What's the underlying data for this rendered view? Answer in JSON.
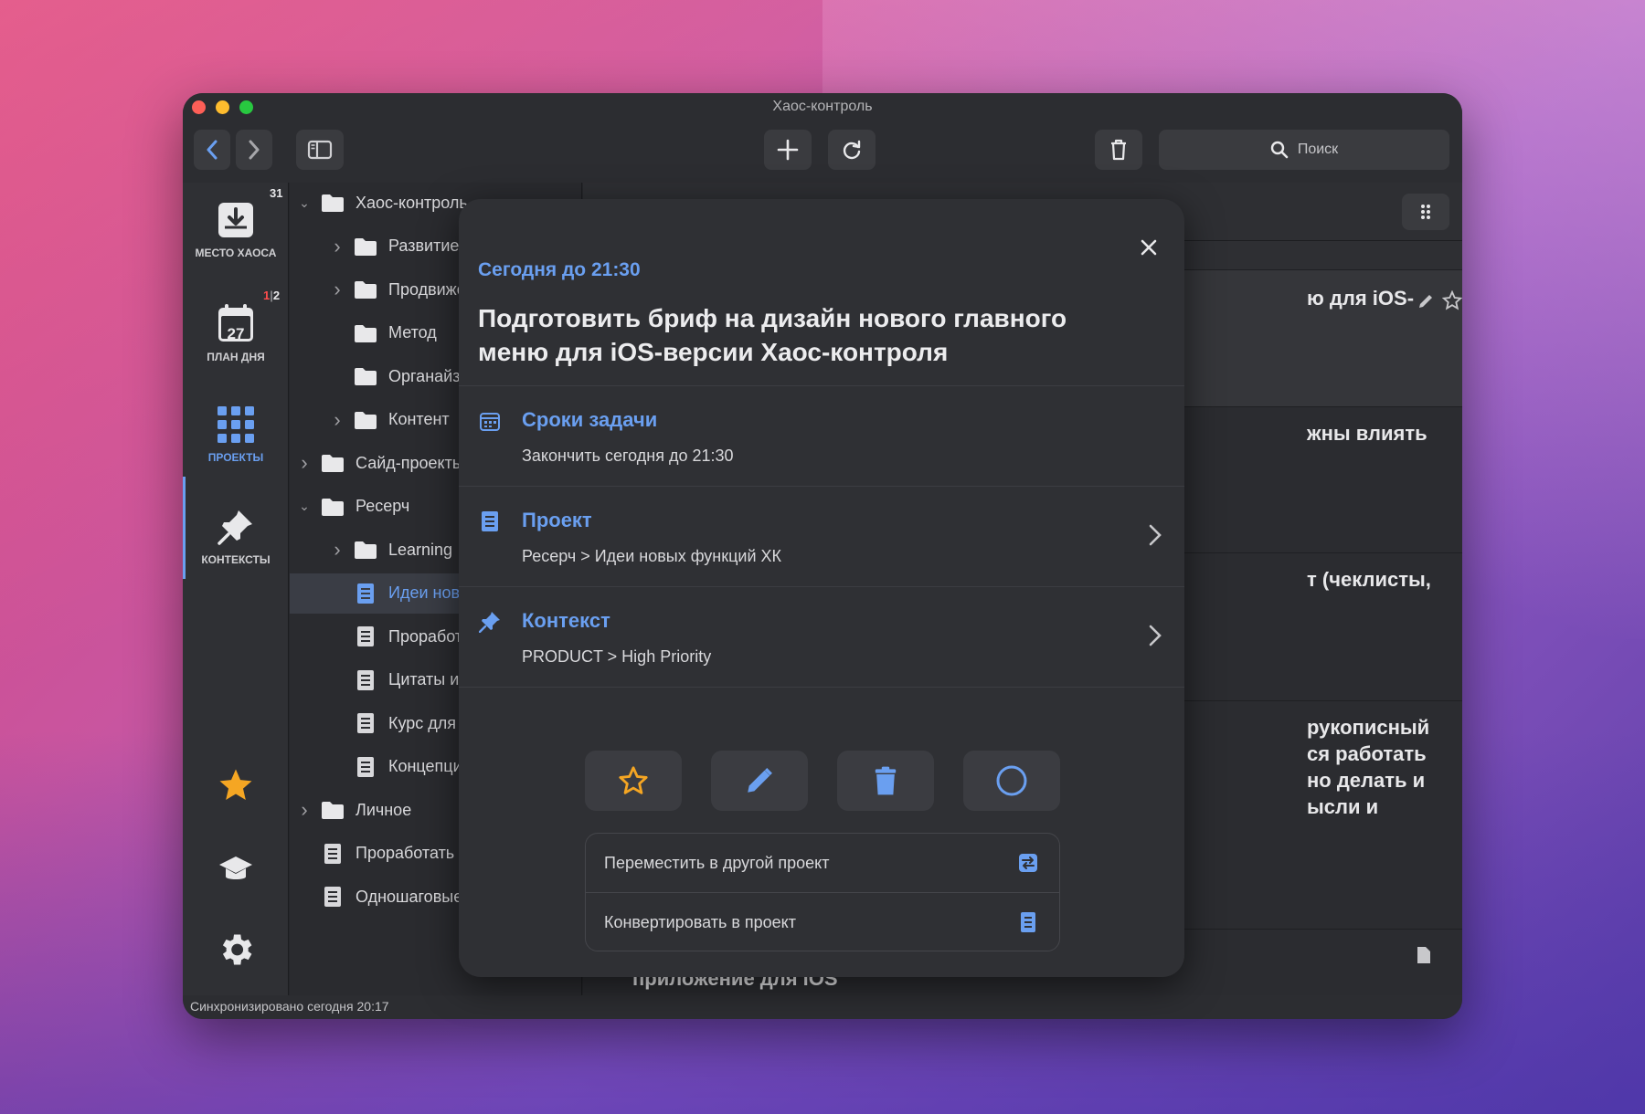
{
  "window": {
    "title": "Хаос-контроль",
    "search_placeholder": "Поиск",
    "status": "Синхронизировано сегодня 20:17"
  },
  "iconbar": {
    "items": [
      {
        "label": "МЕСТО ХАОСА",
        "badge": "31"
      },
      {
        "label": "ПЛАН ДНЯ",
        "badge_red": "1",
        "badge_sep": "|",
        "badge": "2",
        "day": "27"
      },
      {
        "label": "ПРОЕКТЫ"
      },
      {
        "label": "КОНТЕКСТЫ"
      }
    ]
  },
  "tree": {
    "items": [
      {
        "label": "Хаос-контроль",
        "level": 0,
        "expanded": true,
        "type": "folder"
      },
      {
        "label": "Развитие",
        "level": 1,
        "expanded": false,
        "type": "folder"
      },
      {
        "label": "Продвижение",
        "level": 1,
        "expanded": false,
        "type": "folder"
      },
      {
        "label": "Метод",
        "level": 1,
        "type": "folder"
      },
      {
        "label": "Органайзер",
        "level": 1,
        "type": "folder"
      },
      {
        "label": "Контент",
        "level": 1,
        "expanded": false,
        "type": "folder"
      },
      {
        "label": "Сайд-проекты",
        "level": 0,
        "expanded": false,
        "type": "folder"
      },
      {
        "label": "Ресерч",
        "level": 0,
        "expanded": true,
        "type": "folder"
      },
      {
        "label": "Learning",
        "level": 1,
        "expanded": false,
        "type": "folder"
      },
      {
        "label": "Идеи новых функций ХК",
        "level": 1,
        "type": "project",
        "selected": true
      },
      {
        "label": "Проработать",
        "level": 1,
        "type": "project"
      },
      {
        "label": "Цитаты и мысли",
        "level": 1,
        "type": "project"
      },
      {
        "label": "Курс для",
        "level": 1,
        "type": "project"
      },
      {
        "label": "Концепции",
        "level": 1,
        "type": "project"
      },
      {
        "label": "Личное",
        "level": 0,
        "expanded": false,
        "type": "folder"
      },
      {
        "label": "Проработать",
        "level": 0,
        "type": "project"
      },
      {
        "label": "Одношаговые",
        "level": 0,
        "type": "project"
      }
    ]
  },
  "content": {
    "tasks": [
      {
        "text": "ю для iOS-"
      },
      {
        "text": "жны влиять"
      },
      {
        "text": "т (чеклисты,"
      },
      {
        "text": "рукописный\nся работать\nно делать и\nысли и"
      },
      {
        "text": "Статья с описанием механизма добавления превью в приложение для iOS"
      }
    ]
  },
  "modal": {
    "date": "Сегодня до 21:30",
    "title": "Подготовить бриф на дизайн нового главного меню для iOS-версии Хаос-контроля",
    "rows": [
      {
        "label": "Сроки задачи",
        "value": "Закончить сегодня до 21:30",
        "icon": "calendar-icon"
      },
      {
        "label": "Проект",
        "value": "Ресерч > Идеи новых функций ХК",
        "icon": "document-icon"
      },
      {
        "label": "Контекст",
        "value": "PRODUCT > High Priority",
        "icon": "pin-icon"
      }
    ],
    "actions": [
      "star-icon",
      "pencil-icon",
      "trash-icon",
      "circle-icon"
    ],
    "list": [
      {
        "label": "Переместить в другой проект",
        "icon": "move-icon"
      },
      {
        "label": "Конвертировать в проект",
        "icon": "document-icon"
      }
    ]
  },
  "colors": {
    "accent": "#6a9ff0",
    "star": "#f5a623",
    "window_bg": "#26272b",
    "modal_bg": "#2f3034"
  }
}
